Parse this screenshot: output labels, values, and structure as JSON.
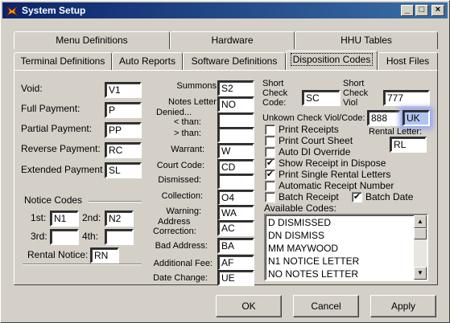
{
  "window": {
    "title": "System Setup"
  },
  "tabs_row1": [
    "Menu Definitions",
    "Hardware",
    "HHU Tables"
  ],
  "tabs_row2": [
    "Terminal Definitions",
    "Auto Reports",
    "Software Definitions",
    "Disposition Codes",
    "Host Files"
  ],
  "left": {
    "void_label": "Void:",
    "void_value": "V1",
    "full_label": "Full Payment:",
    "full_value": "P",
    "partial_label": "Partial Payment:",
    "partial_value": "PP",
    "reverse_label": "Reverse Payment:",
    "reverse_value": "RC",
    "extended_label": "Extended Payment",
    "extended_value": "SL"
  },
  "notice": {
    "heading": "Notice Codes",
    "first_label": "1st:",
    "first_value": "N1",
    "second_label": "2nd:",
    "second_value": "N2",
    "third_label": "3rd:",
    "third_value": "",
    "fourth_label": "4th:",
    "fourth_value": "",
    "rental_label": "Rental Notice:",
    "rental_value": "RN"
  },
  "mid": {
    "summons_label": "Summons:",
    "summons_value": "S2",
    "notes_label": "Notes Letter:",
    "notes_value": "NO",
    "denied_label": "Denied...",
    "lt_label": "< than:",
    "lt_value": "",
    "gt_label": "> than:",
    "gt_value": "",
    "warrant_label": "Warrant:",
    "warrant_value": "W",
    "court_label": "Court Code:",
    "court_value": "CD",
    "dismissed_label": "Dismissed:",
    "dismissed_value": "",
    "collection_label": "Collection:",
    "collection_value": "O4",
    "warning_label": "Warning:",
    "warning_value": "WA",
    "address_label_1": "Address",
    "address_label_2": "Correction:",
    "address_value": "AC",
    "bad_label": "Bad Address:",
    "bad_value": "BA",
    "fee_label": "Additional Fee:",
    "fee_value": "AF",
    "date_label": "Date Change:",
    "date_value": "UE"
  },
  "right": {
    "short_check_code_1": "Short",
    "short_check_code_2": "Check",
    "short_check_code_3": "Code:",
    "short_check_code_value": "SC",
    "short_check_viol_1": "Short",
    "short_check_viol_2": "Check",
    "short_check_viol_3": "Viol",
    "short_check_viol_value": "777",
    "unknown_label": "Unkown Check Viol/Code:",
    "unknown_viol_value": "888",
    "unknown_code_value": "UK",
    "rental_letter_label": "Rental Letter:",
    "rental_letter_value": "RL",
    "checkboxes": [
      {
        "label": "Print Receipts",
        "checked": false
      },
      {
        "label": "Print Court Sheet",
        "checked": false
      },
      {
        "label": "Auto DI Override",
        "checked": false
      },
      {
        "label": "Show Receipt in Dispose",
        "checked": true
      },
      {
        "label": "Print Single Rental Letters",
        "checked": true
      },
      {
        "label": "Automatic Receipt Number",
        "checked": false
      },
      {
        "label": "Batch Receipt",
        "checked": false
      }
    ],
    "batch_date": {
      "label": "Batch Date",
      "checked": true
    },
    "available_label": "Available Codes:",
    "available_codes": [
      "D  DISMISSED",
      "DN DISMISS",
      "MM MAYWOOD",
      "N1 NOTICE LETTER",
      "NO NOTES LETTER"
    ]
  },
  "buttons": {
    "ok": "OK",
    "cancel": "Cancel",
    "apply": "Apply"
  },
  "glyphs": {
    "check": "✔",
    "up": "▲",
    "down": "▼",
    "minimize": "_",
    "maximize": "□",
    "close": "×"
  }
}
